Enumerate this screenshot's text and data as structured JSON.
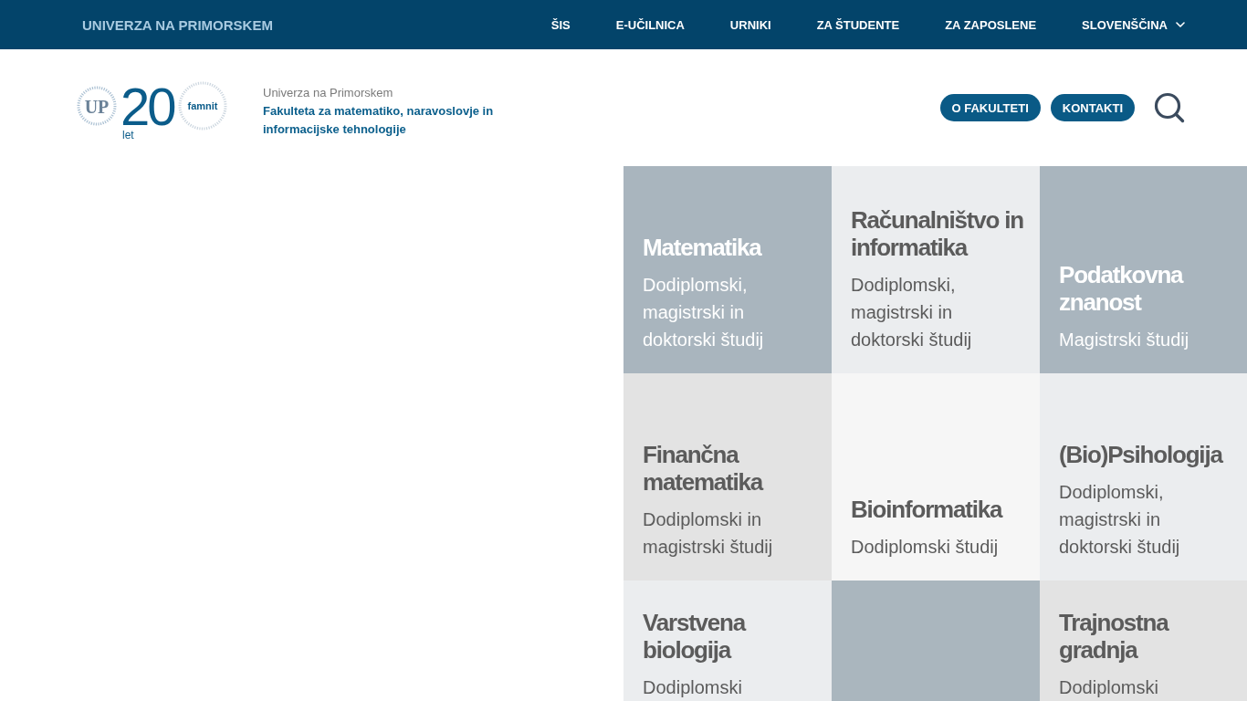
{
  "top_bar": {
    "brand": "UNIVERZA NA PRIMORSKEM",
    "nav": [
      "ŠIS",
      "E-UČILNICA",
      "URNIKI",
      "ZA ŠTUDENTE",
      "ZA ZAPOSLENE"
    ],
    "language": "SLOVENŠČINA"
  },
  "header": {
    "logo": {
      "monogram": "UP",
      "number": "20",
      "years": "let",
      "name": "famnit"
    },
    "university": "Univerza na Primorskem",
    "faculty": "Fakulteta za matematiko, naravoslovje in informacijske tehnologije",
    "buttons": [
      "O FAKULTETI",
      "KONTAKTI"
    ]
  },
  "tiles": [
    {
      "title": "Matematika",
      "description": "Dodiplomski, magistrski in doktorski študij",
      "color": "#a9b5be"
    },
    {
      "title": "Računalništvo in informatika",
      "description": "Dodiplomski, magistrski in doktorski študij",
      "color": "#ebedef"
    },
    {
      "title": "Podatkovna znanost",
      "description": "Magistrski študij",
      "color": "#a9b5be"
    },
    {
      "title": "Finančna matematika",
      "description": "Dodiplomski in magistrski študij",
      "color": "#e3e3e3"
    },
    {
      "title": "Bioinformatika",
      "description": "Dodiplomski študij",
      "color": "#f6f6f6"
    },
    {
      "title": "(Bio)Psihologija",
      "description": "Dodiplomski, magistrski in doktorski študij",
      "color": "#ebedef"
    },
    {
      "title": "Varstvena biologija",
      "description": "Dodiplomski",
      "color": "#ebedef"
    },
    {
      "color": "#aab6be"
    },
    {
      "title": "Trajnostna gradnja",
      "description": "Dodiplomski",
      "color": "#e3e3e3"
    }
  ]
}
